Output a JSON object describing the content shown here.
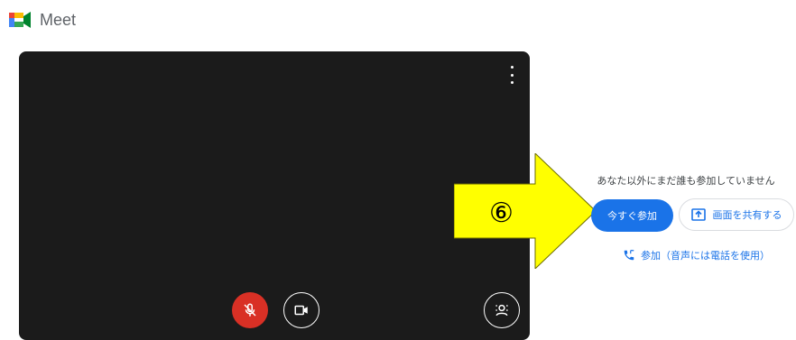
{
  "app": {
    "name": "Meet"
  },
  "preview": {
    "mic_state": "muted",
    "camera_state": "off"
  },
  "annotation": {
    "label": "⑥",
    "color": "#ffff00"
  },
  "side_panel": {
    "status": "あなた以外にまだ誰も参加していません",
    "join_label": "今すぐ参加",
    "present_label": "画面を共有する",
    "phone_join_label": "参加（音声には電話を使用）"
  },
  "colors": {
    "accent": "#1a73e8",
    "mic_off": "#d93025",
    "preview_bg": "#1b1b1b"
  },
  "icons": [
    "meet-logo-icon",
    "more-vert-icon",
    "mic-off-icon",
    "camera-icon",
    "effects-icon",
    "present-icon",
    "phone-icon"
  ]
}
